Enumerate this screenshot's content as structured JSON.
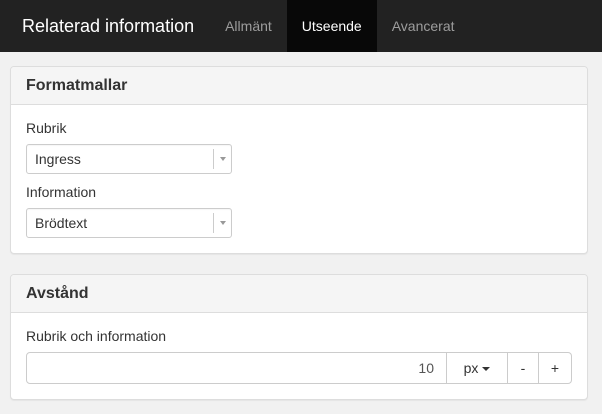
{
  "navbar": {
    "brand": "Relaterad information",
    "tabs": [
      {
        "label": "Allmänt"
      },
      {
        "label": "Utseende"
      },
      {
        "label": "Avancerat"
      }
    ],
    "active_tab": "Utseende"
  },
  "formatmallar": {
    "heading": "Formatmallar",
    "rubrik": {
      "label": "Rubrik",
      "value": "Ingress"
    },
    "information": {
      "label": "Information",
      "value": "Brödtext"
    }
  },
  "avstand": {
    "heading": "Avstånd",
    "field": {
      "label": "Rubrik och information",
      "value": "10",
      "unit": "px",
      "minus": "-",
      "plus": "+"
    }
  },
  "colors": {
    "navbar_bg": "#222222",
    "active_tab_bg": "#080808",
    "page_bg": "#f1f1f1",
    "panel_heading_bg": "#f5f5f5"
  },
  "icons": [
    "chevron-down-icon",
    "caret-down-icon"
  ]
}
